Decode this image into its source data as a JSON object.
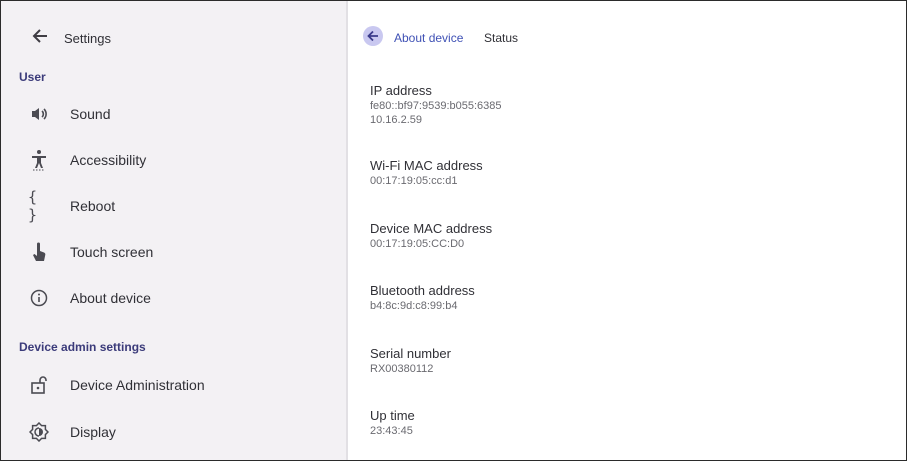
{
  "left": {
    "title": "Settings",
    "sections": [
      {
        "header": "User"
      },
      {
        "header": "Device admin settings"
      }
    ],
    "items": [
      {
        "label": "Sound",
        "icon": "speaker-icon"
      },
      {
        "label": "Accessibility",
        "icon": "accessibility-icon"
      },
      {
        "label": "Reboot",
        "icon": "braces-icon"
      },
      {
        "label": "Touch screen",
        "icon": "touch-icon"
      },
      {
        "label": "About device",
        "icon": "info-icon"
      },
      {
        "label": "Device Administration",
        "icon": "unlock-icon"
      },
      {
        "label": "Display",
        "icon": "brightness-icon"
      }
    ]
  },
  "right": {
    "breadcrumb": {
      "back_icon": "back-arrow-icon",
      "parent": "About device",
      "current": "Status"
    },
    "info": [
      {
        "key": "IP address",
        "values": [
          "fe80::bf97:9539:b055:6385",
          "10.16.2.59"
        ]
      },
      {
        "key": "Wi-Fi MAC address",
        "values": [
          "00:17:19:05:cc:d1"
        ]
      },
      {
        "key": "Device MAC address",
        "values": [
          "00:17:19:05:CC:D0"
        ]
      },
      {
        "key": "Bluetooth address",
        "values": [
          "b4:8c:9d:c8:99:b4"
        ]
      },
      {
        "key": "Serial number",
        "values": [
          "RX00380112"
        ]
      },
      {
        "key": "Up time",
        "values": [
          "23:43:45"
        ]
      }
    ]
  },
  "colors": {
    "sidebar_bg": "#f3f1f4",
    "accent": "#3f51b5",
    "section_header": "#3b3b7a"
  }
}
